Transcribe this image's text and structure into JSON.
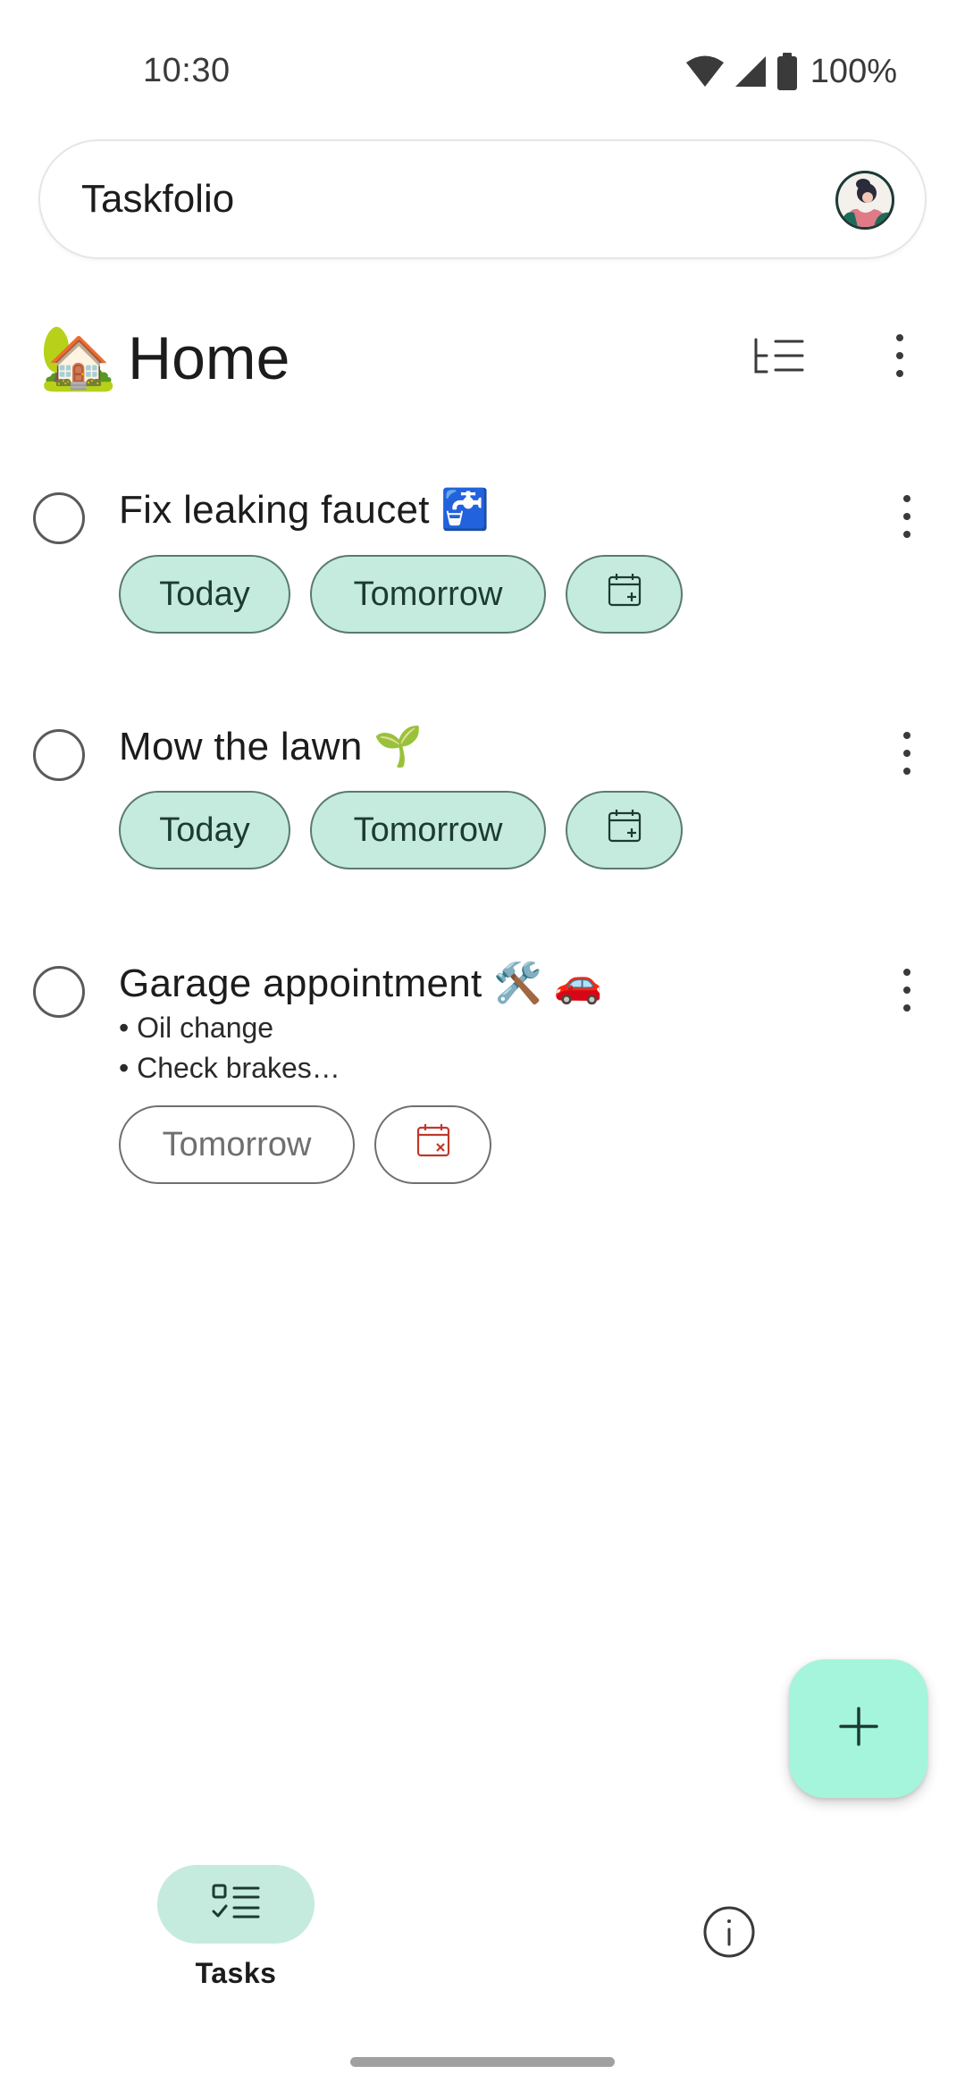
{
  "status_bar": {
    "time": "10:30",
    "battery": "100%",
    "icons": [
      "wifi-icon",
      "signal-icon",
      "battery-icon"
    ]
  },
  "app_bar": {
    "title": "Taskfolio",
    "avatar": "avatar"
  },
  "list": {
    "emoji": "🏡",
    "title": "Home",
    "actions": [
      "sort-icon",
      "more-vert-icon"
    ]
  },
  "tasks": [
    {
      "title": "Fix leaking faucet 🚰",
      "chips": {
        "today": "Today",
        "tomorrow": "Tomorrow",
        "pick_date_icon": "calendar-add-icon"
      }
    },
    {
      "title": "Mow the lawn 🌱",
      "chips": {
        "today": "Today",
        "tomorrow": "Tomorrow",
        "pick_date_icon": "calendar-add-icon"
      }
    },
    {
      "title": "Garage appointment 🛠️ 🚗",
      "note_lines": [
        "• Oil change",
        "• Check brakes…"
      ],
      "chips": {
        "tomorrow": "Tomorrow",
        "clear_date_icon": "calendar-remove-icon"
      }
    }
  ],
  "fab": {
    "icon": "plus-icon"
  },
  "bottom_nav": {
    "tasks_label": "Tasks",
    "tasks_icon": "checklist-icon",
    "info_icon": "info-icon"
  },
  "colors": {
    "accent_chip": "#c5ebde",
    "fab": "#a4f5dc",
    "chip_text": "#1d3b30",
    "danger": "#c0392b"
  }
}
